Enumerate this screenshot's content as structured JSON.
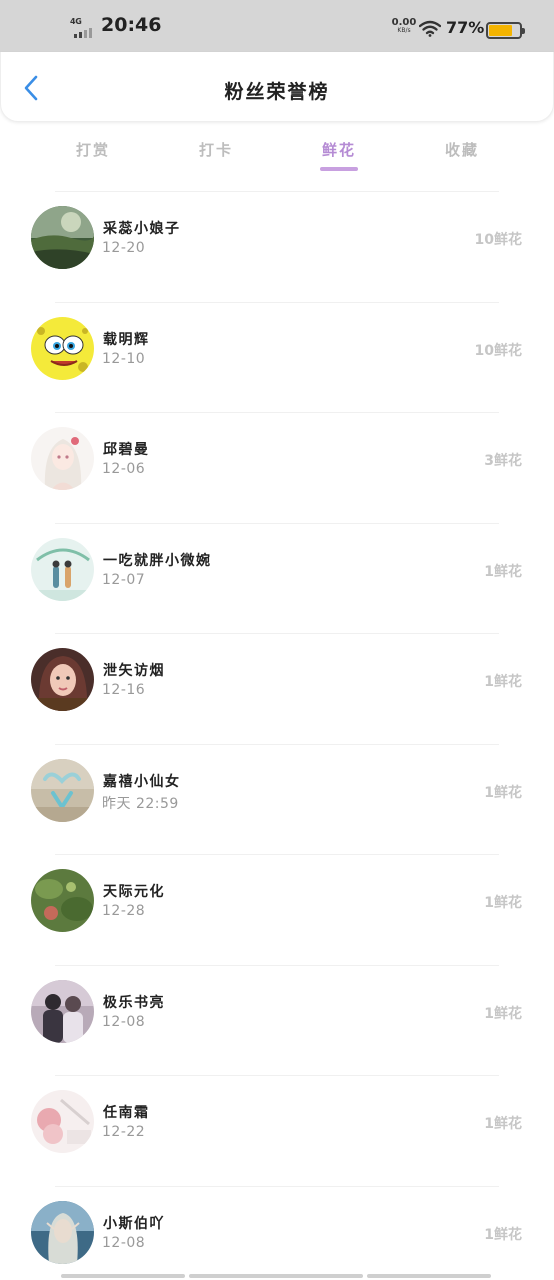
{
  "status_bar": {
    "network": "4G",
    "time": "20:46",
    "speed_value": "0.00",
    "speed_unit": "KB/s",
    "battery": "77%",
    "battery_level": 0.77
  },
  "header": {
    "title": "粉丝荣誉榜",
    "back_icon": "chevron-left-icon"
  },
  "tabs": [
    {
      "label": "打赏",
      "active": false
    },
    {
      "label": "打卡",
      "active": false
    },
    {
      "label": "鲜花",
      "active": true
    },
    {
      "label": "收藏",
      "active": false
    }
  ],
  "colors": {
    "accent": "#c8a0e0",
    "active_tab_text": "#b58bd4",
    "inactive_tab_text": "#bdbdbd",
    "back_icon": "#3a8ee6",
    "amount_text": "#c6c6c6"
  },
  "fans": [
    {
      "name": "采蕊小娘子",
      "date": "12-20",
      "amount": "10鲜花",
      "avatar": "landscape-avatar"
    },
    {
      "name": "载明辉",
      "date": "12-10",
      "amount": "10鲜花",
      "avatar": "cartoon-sponge-avatar"
    },
    {
      "name": "邱碧曼",
      "date": "12-06",
      "amount": "3鲜花",
      "avatar": "anime-girl-avatar"
    },
    {
      "name": "一吃就胖小微婉",
      "date": "12-07",
      "amount": "1鲜花",
      "avatar": "couple-illustration-avatar"
    },
    {
      "name": "泄矢访烟",
      "date": "12-16",
      "amount": "1鲜花",
      "avatar": "girl-portrait-avatar"
    },
    {
      "name": "嘉禧小仙女",
      "date": "昨天 22:59",
      "amount": "1鲜花",
      "avatar": "heart-hands-avatar"
    },
    {
      "name": "天际元化",
      "date": "12-28",
      "amount": "1鲜花",
      "avatar": "plant-avatar"
    },
    {
      "name": "极乐书亮",
      "date": "12-08",
      "amount": "1鲜花",
      "avatar": "couple-photo-avatar"
    },
    {
      "name": "任南霜",
      "date": "12-22",
      "amount": "1鲜花",
      "avatar": "pink-flower-avatar"
    },
    {
      "name": "小斯伯吖",
      "date": "12-08",
      "amount": "1鲜花",
      "avatar": "elf-portrait-avatar"
    }
  ]
}
